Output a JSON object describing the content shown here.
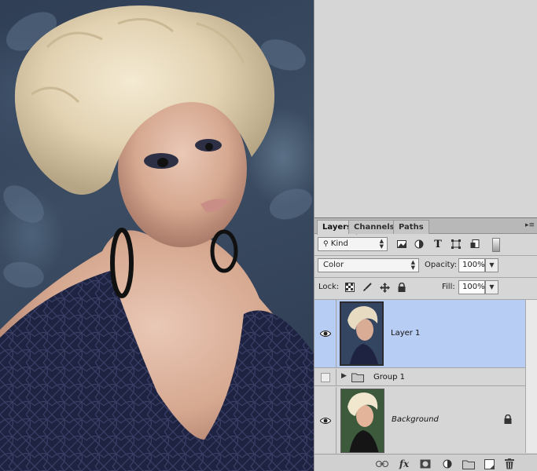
{
  "panel": {
    "tabs": [
      {
        "label": "Layers"
      },
      {
        "label": "Channels"
      },
      {
        "label": "Paths"
      }
    ],
    "filter": {
      "label": "Kind"
    },
    "blend_mode": "Color",
    "opacity": {
      "label": "Opacity:",
      "value": "100%"
    },
    "lock": {
      "label": "Lock:"
    },
    "fill": {
      "label": "Fill:",
      "value": "100%"
    },
    "layers": [
      {
        "name": "Layer 1",
        "selected": true,
        "visible": true
      },
      {
        "name": "Group 1",
        "selected": false,
        "visible": false
      },
      {
        "name": "Background",
        "selected": false,
        "visible": true,
        "locked": true
      }
    ]
  },
  "colors": {
    "selection": "#b8cdf4",
    "panel_bg": "#d6d6d6"
  },
  "icons": {
    "filter": [
      "image-icon",
      "adjustment-icon",
      "type-icon",
      "shape-icon",
      "smart-object-icon",
      "filter-toggle"
    ],
    "lock": [
      "lock-transparent-icon",
      "lock-image-icon",
      "lock-position-icon",
      "lock-all-icon"
    ],
    "bottom": [
      "link-icon",
      "fx-icon",
      "mask-icon",
      "adjustment-layer-icon",
      "new-group-icon",
      "new-layer-icon",
      "trash-icon"
    ]
  }
}
